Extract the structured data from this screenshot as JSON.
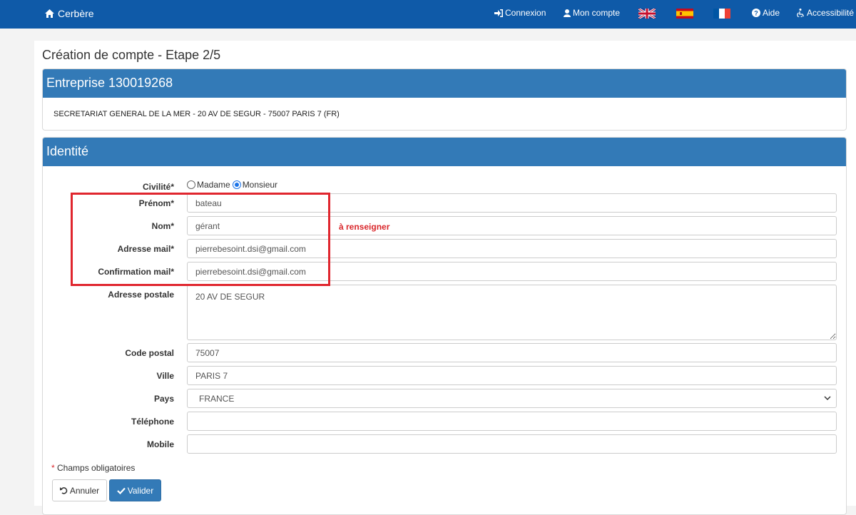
{
  "navbar": {
    "brand": "Cerbère",
    "login": "Connexion",
    "account": "Mon compte",
    "help": "Aide",
    "accessibility": "Accessibilité"
  },
  "page": {
    "title": "Création de compte - Etape 2/5"
  },
  "company": {
    "header": "Entreprise 130019268",
    "address": "SECRETARIAT GENERAL DE LA MER - 20 AV DE SEGUR - 75007 PARIS 7 (FR)"
  },
  "identity": {
    "header": "Identité",
    "civility_label": "Civilité*",
    "civility_options": [
      "Madame",
      "Monsieur"
    ],
    "civility_selected": "Monsieur",
    "firstname_label": "Prénom*",
    "firstname_value": "bateau",
    "lastname_label": "Nom*",
    "lastname_value": "gérant",
    "lastname_error": "à renseigner",
    "email_label": "Adresse mail*",
    "email_value": "pierrebesoint.dsi@gmail.com",
    "email_confirm_label": "Confirmation mail*",
    "email_confirm_value": "pierrebesoint.dsi@gmail.com",
    "postal_label": "Adresse postale",
    "postal_value": "20 AV DE SEGUR",
    "zip_label": "Code postal",
    "zip_value": "75007",
    "city_label": "Ville",
    "city_value": "PARIS 7",
    "country_label": "Pays",
    "country_value": "FRANCE",
    "phone_label": "Téléphone",
    "phone_value": "",
    "mobile_label": "Mobile",
    "mobile_value": ""
  },
  "form": {
    "required_star": "*",
    "required_note": " Champs obligatoires",
    "cancel_label": "Annuler",
    "submit_label": "Valider"
  },
  "colors": {
    "navbar": "#0f5aa8",
    "panel_header": "#337ab7",
    "error": "#d9262a"
  }
}
